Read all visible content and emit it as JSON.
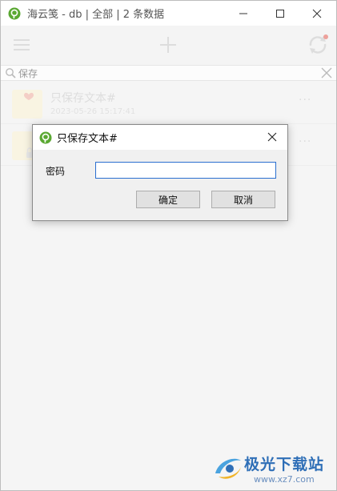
{
  "window": {
    "title": "海云笺 - db | 全部 | 2 条数据",
    "app_icon": "app-logo-icon",
    "controls": {
      "minimize": "minimize-icon",
      "maximize": "maximize-icon",
      "close": "close-icon"
    }
  },
  "toolbar": {
    "menu_icon": "hamburger-icon",
    "add_icon": "plus-icon",
    "sync_icon": "sync-icon"
  },
  "search": {
    "value": "保存",
    "icon": "search-icon",
    "clear_icon": "clear-icon"
  },
  "list": {
    "items": [
      {
        "title": "只保存文本#",
        "time": "2023-05-26 15:17:41",
        "more": "···"
      },
      {
        "title": "",
        "time": "",
        "more": "···"
      }
    ]
  },
  "dialog": {
    "title": "只保存文本#",
    "password_label": "密码",
    "password_value": "",
    "ok_label": "确定",
    "cancel_label": "取消"
  },
  "watermark": {
    "text": "极光下载站",
    "url": "www.xz7.com"
  },
  "colors": {
    "accent": "#2a6fd0",
    "app_green": "#5aa832",
    "sync_badge": "#e8736b"
  }
}
